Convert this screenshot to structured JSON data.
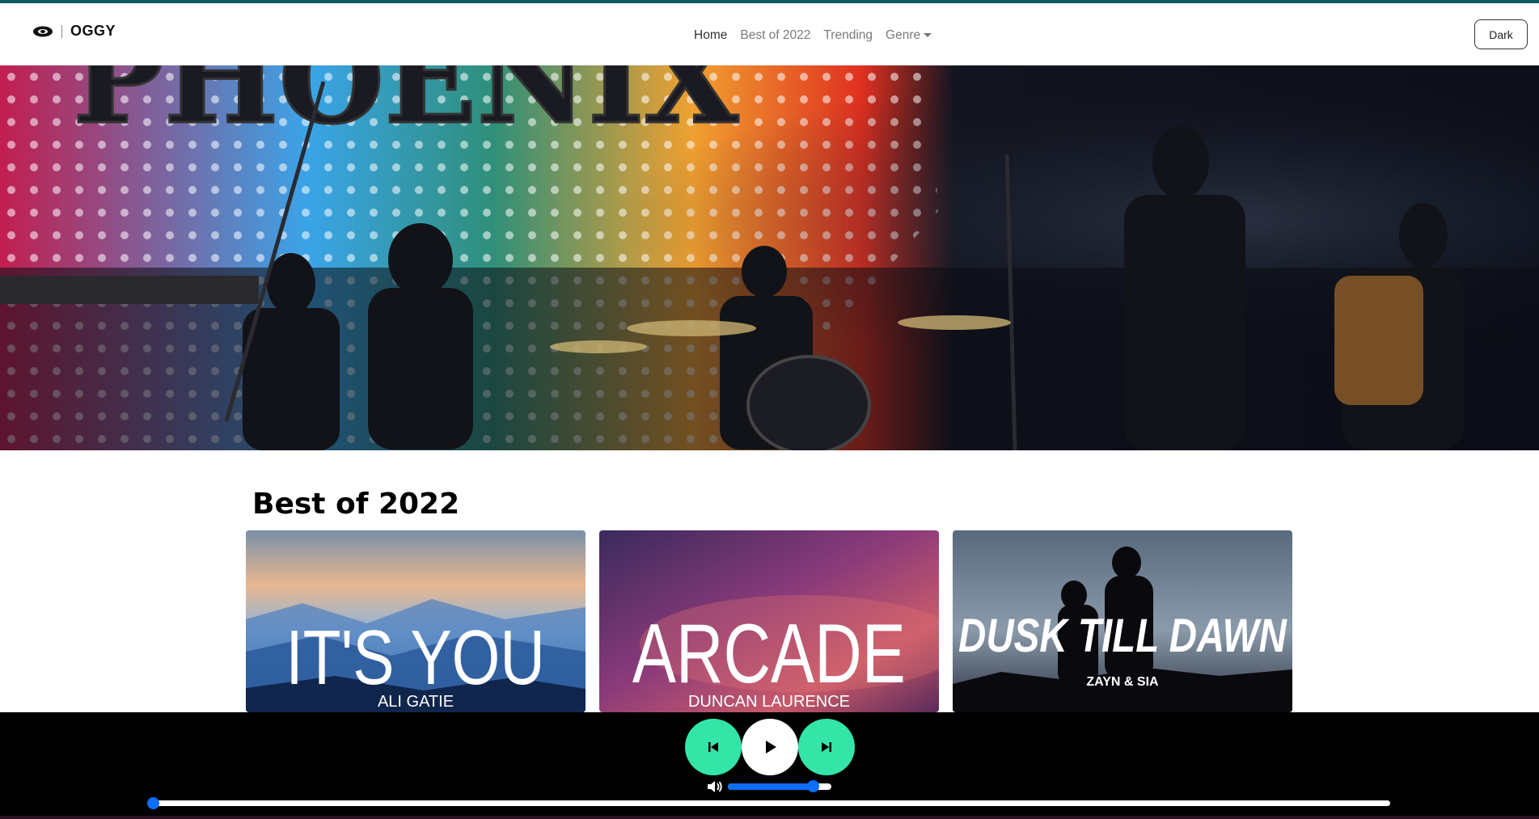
{
  "brand": {
    "name": "OGGY",
    "logo_icon": "eye-logo-icon"
  },
  "nav": {
    "items": [
      {
        "label": "Home",
        "active": true
      },
      {
        "label": "Best of 2022",
        "active": false
      },
      {
        "label": "Trending",
        "active": false
      },
      {
        "label": "Genre",
        "active": false,
        "dropdown": true
      }
    ]
  },
  "theme_toggle": {
    "label": "Dark"
  },
  "hero": {
    "sign_text": "PHOENIX"
  },
  "section": {
    "title": "Best of 2022"
  },
  "cards": [
    {
      "title": "IT'S YOU",
      "artist": "ALI GATIE"
    },
    {
      "title": "ARCADE",
      "artist": "DUNCAN LAURENCE"
    },
    {
      "title": "DUSK TILL DAWN",
      "artist": "ZAYN & SIA"
    }
  ],
  "player": {
    "accent_color": "#33e6a8",
    "slider_color": "#0d6efd",
    "volume_percent": 82,
    "progress_percent": 0,
    "controls": [
      "previous-track-icon",
      "play-icon",
      "next-track-icon"
    ]
  }
}
